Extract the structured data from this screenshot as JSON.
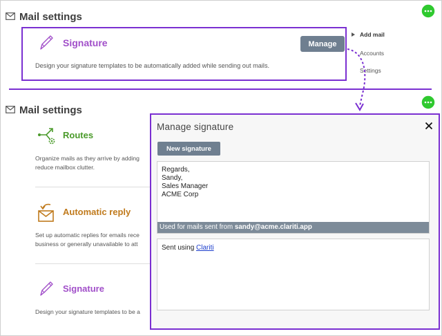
{
  "top": {
    "title": "Mail settings",
    "signature_card": {
      "title": "Signature",
      "description": "Design your signature templates to be automatically added while sending out mails.",
      "manage_label": "Manage"
    },
    "nav": [
      {
        "label": "Add mail",
        "active": true
      },
      {
        "label": "Accounts",
        "active": false
      },
      {
        "label": "Settings",
        "active": false
      }
    ]
  },
  "bottom": {
    "title": "Mail settings",
    "features": [
      {
        "title": "Routes",
        "desc1": "Organize mails as they arrive by adding",
        "desc2": "reduce mailbox clutter.",
        "color": "#4a9a2a",
        "icon": "routes-icon"
      },
      {
        "title": "Automatic reply",
        "desc1": "Set up automatic replies for emails rece",
        "desc2": "business or generally unavailable to att",
        "color": "#c07a1c",
        "icon": "reply-envelope-icon"
      },
      {
        "title": "Signature",
        "desc1": "Design your signature templates to be a",
        "desc2": "",
        "color": "#a14fc9",
        "icon": "pen-icon"
      }
    ]
  },
  "modal": {
    "title": "Manage signature",
    "new_signature_label": "New signature",
    "signature_lines": [
      "Regards,",
      "Sandy,",
      "Sales Manager",
      "ACME Corp"
    ],
    "footer_prefix": "Used for mails sent from ",
    "footer_email": "sandy@acme.clariti.app",
    "sent_prefix": "Sent using ",
    "sent_link": "Clariti"
  },
  "colors": {
    "accent": "#7a2fd1",
    "signature_purple": "#a14fc9",
    "routes_green": "#4a9a2a",
    "reply_orange": "#c07a1c",
    "button_gray": "#6f7f90",
    "chat_green": "#2fc92f"
  }
}
